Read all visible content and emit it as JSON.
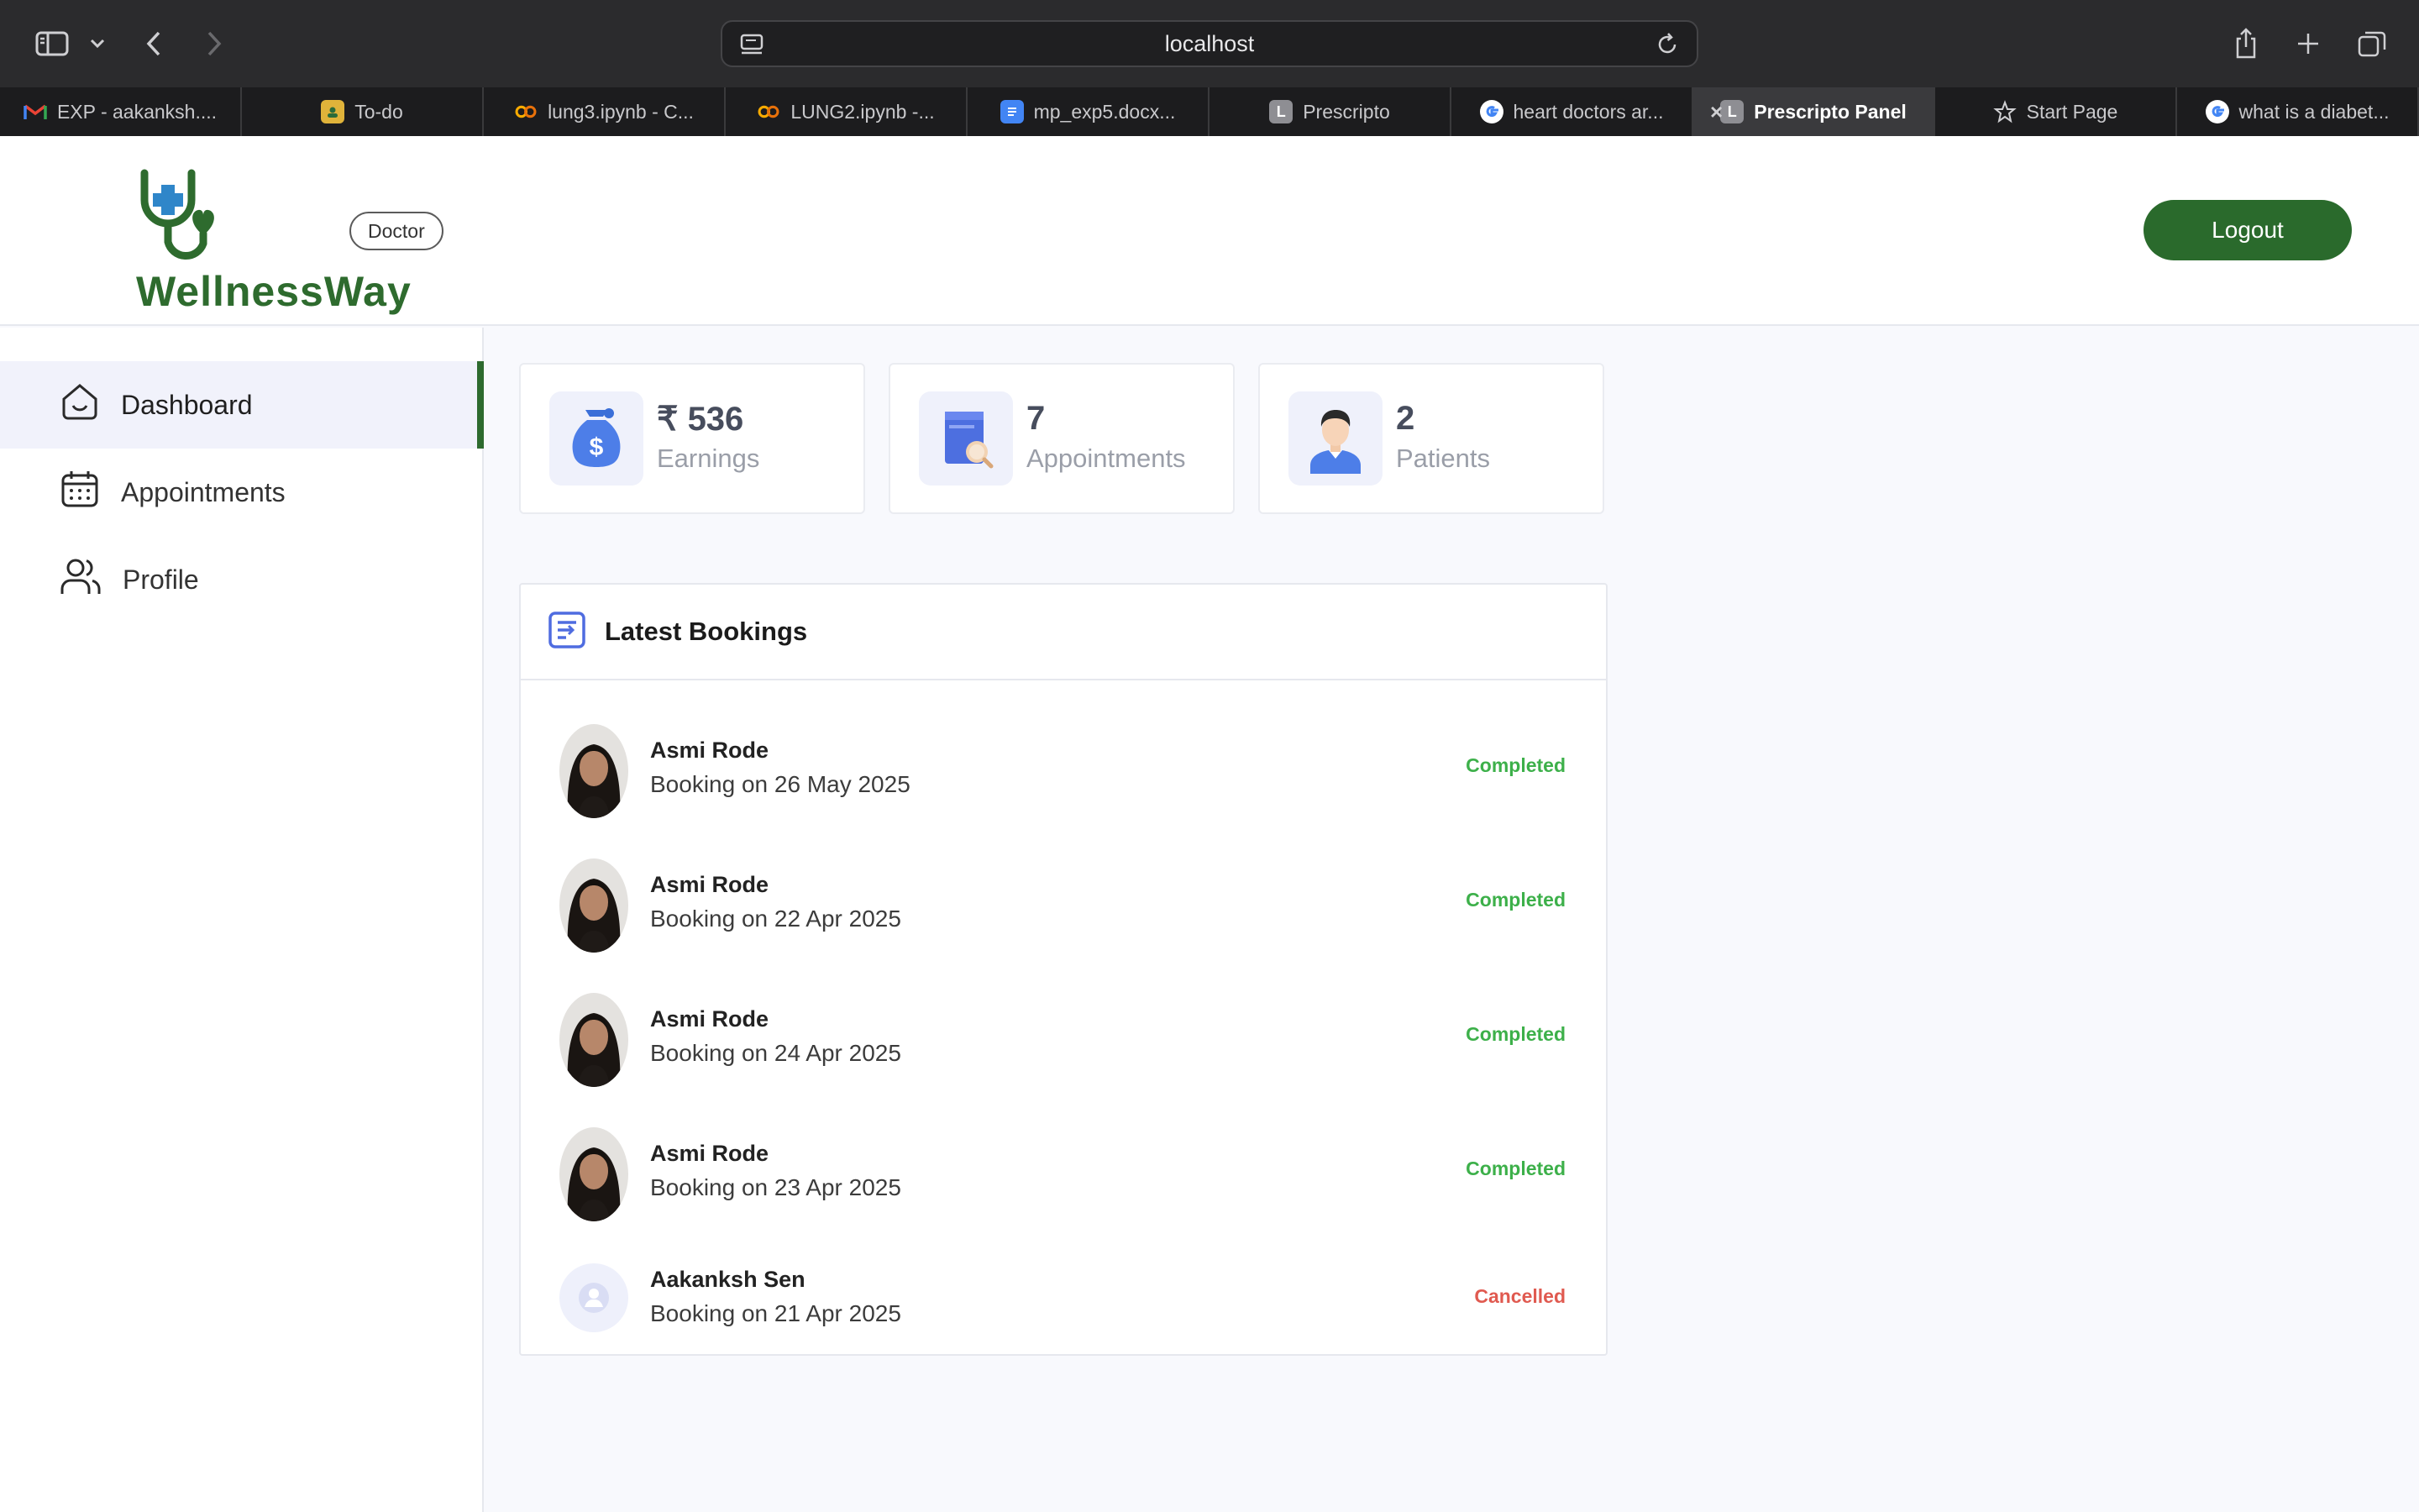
{
  "browser": {
    "url": "localhost",
    "tabs": [
      {
        "label": "EXP - aakanksh....",
        "icon": "gmail-icon",
        "color": "#ea4335",
        "active": false
      },
      {
        "label": "To-do",
        "icon": "contact-card-icon",
        "color": "#e0b33a",
        "active": false
      },
      {
        "label": "lung3.ipynb - C...",
        "icon": "colab-icon",
        "color": "#f9ab00",
        "active": false
      },
      {
        "label": "LUNG2.ipynb -...",
        "icon": "colab-icon",
        "color": "#f9ab00",
        "active": false
      },
      {
        "label": "mp_exp5.docx...",
        "icon": "google-docs-icon",
        "color": "#4285f4",
        "active": false
      },
      {
        "label": "Prescripto",
        "icon": "letter-l-icon",
        "letter": "L",
        "active": false
      },
      {
        "label": "heart doctors ar...",
        "icon": "google-icon",
        "active": false
      },
      {
        "label": "Prescripto Panel",
        "icon": "letter-l-icon",
        "letter": "L",
        "active": true
      },
      {
        "label": "Start Page",
        "icon": "star-icon",
        "active": false
      },
      {
        "label": "what is a diabet...",
        "icon": "google-icon",
        "active": false
      }
    ]
  },
  "header": {
    "logo_text": "WellnessWay",
    "role_badge": "Doctor",
    "logout_label": "Logout",
    "brand_color": "#2a6a2c"
  },
  "sidebar": {
    "items": [
      {
        "label": "Dashboard",
        "icon": "home-icon",
        "active": true
      },
      {
        "label": "Appointments",
        "icon": "calendar-icon",
        "active": false
      },
      {
        "label": "Profile",
        "icon": "users-icon",
        "active": false
      }
    ]
  },
  "stats": [
    {
      "value": "₹ 536",
      "label": "Earnings",
      "icon": "money-bag-icon"
    },
    {
      "value": "7",
      "label": "Appointments",
      "icon": "appointment-book-icon"
    },
    {
      "value": "2",
      "label": "Patients",
      "icon": "patient-icon"
    }
  ],
  "latest_bookings": {
    "title": "Latest Bookings",
    "icon": "list-icon",
    "rows": [
      {
        "name": "Asmi Rode",
        "date": "Booking on 26 May 2025",
        "status": "Completed",
        "avatar": "photo"
      },
      {
        "name": "Asmi Rode",
        "date": "Booking on 22 Apr 2025",
        "status": "Completed",
        "avatar": "photo"
      },
      {
        "name": "Asmi Rode",
        "date": "Booking on 24 Apr 2025",
        "status": "Completed",
        "avatar": "photo"
      },
      {
        "name": "Asmi Rode",
        "date": "Booking on 23 Apr 2025",
        "status": "Completed",
        "avatar": "photo"
      },
      {
        "name": "Aakanksh Sen",
        "date": "Booking on 21 Apr 2025",
        "status": "Cancelled",
        "avatar": "placeholder"
      }
    ],
    "status_colors": {
      "Completed": "#3db04a",
      "Cancelled": "#e05a50"
    }
  }
}
